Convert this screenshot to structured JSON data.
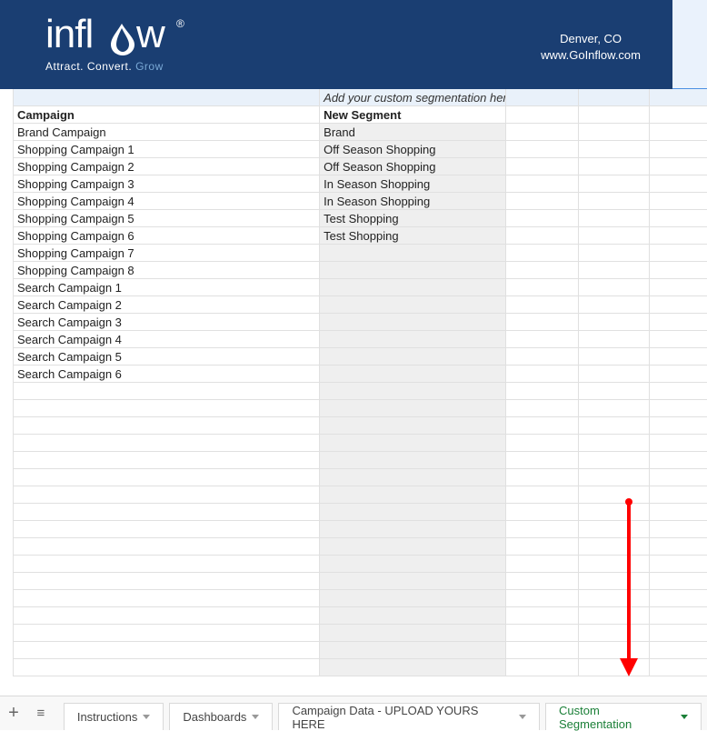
{
  "header": {
    "brand": "inflow",
    "tagline_attract": "Attract.",
    "tagline_convert": "Convert.",
    "tagline_grow": "Grow",
    "location": "Denver, CO",
    "url": "www.GoInflow.com"
  },
  "sheet": {
    "hint": "Add your custom segmentation here.",
    "col_campaign": "Campaign",
    "col_segment": "New Segment",
    "rows": [
      {
        "campaign": "Brand Campaign",
        "segment": "Brand"
      },
      {
        "campaign": "Shopping Campaign 1",
        "segment": "Off Season Shopping"
      },
      {
        "campaign": "Shopping Campaign 2",
        "segment": "Off Season Shopping"
      },
      {
        "campaign": "Shopping Campaign 3",
        "segment": "In Season Shopping"
      },
      {
        "campaign": "Shopping Campaign 4",
        "segment": "In Season Shopping"
      },
      {
        "campaign": "Shopping Campaign 5",
        "segment": "Test Shopping"
      },
      {
        "campaign": "Shopping Campaign 6",
        "segment": "Test Shopping"
      },
      {
        "campaign": "Shopping Campaign 7",
        "segment": ""
      },
      {
        "campaign": "Shopping Campaign 8",
        "segment": ""
      },
      {
        "campaign": "Search Campaign 1",
        "segment": ""
      },
      {
        "campaign": "Search Campaign 2",
        "segment": ""
      },
      {
        "campaign": "Search Campaign 3",
        "segment": ""
      },
      {
        "campaign": "Search Campaign 4",
        "segment": ""
      },
      {
        "campaign": "Search Campaign 5",
        "segment": ""
      },
      {
        "campaign": "Search Campaign 6",
        "segment": ""
      }
    ],
    "empty_rows": 17
  },
  "tabs": {
    "items": [
      {
        "label": "Instructions",
        "active": false
      },
      {
        "label": "Dashboards",
        "active": false
      },
      {
        "label": "Campaign Data - UPLOAD YOURS HERE",
        "active": false
      },
      {
        "label": "Custom Segmentation",
        "active": true
      }
    ]
  }
}
